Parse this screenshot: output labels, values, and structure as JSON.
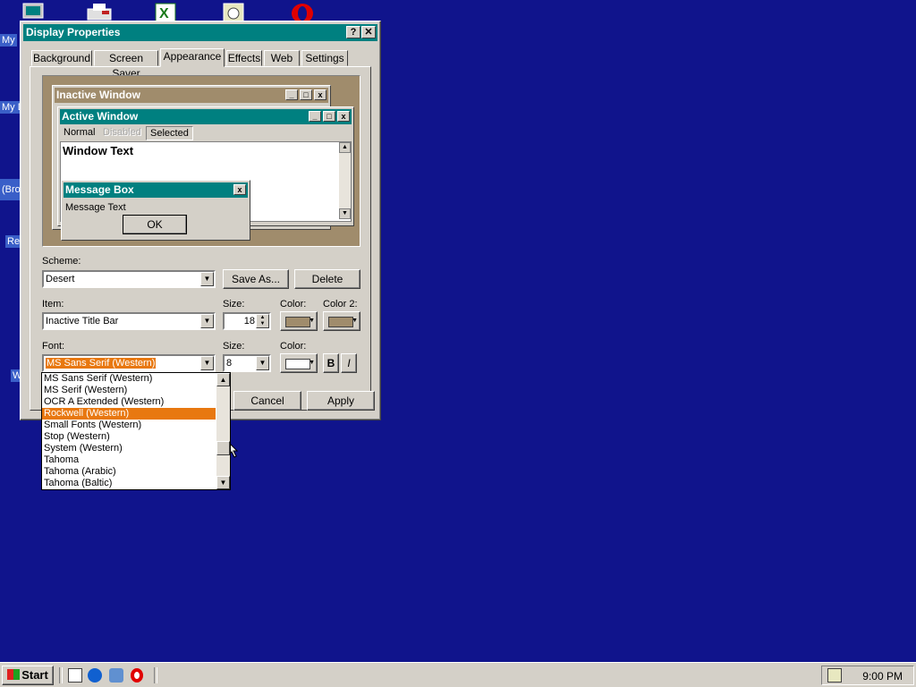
{
  "desktop": {
    "labels": [
      "My",
      "My D",
      "(Bro",
      "Re",
      "W"
    ]
  },
  "dialog": {
    "title": "Display Properties",
    "help_btn": "?",
    "close_btn": "✕",
    "tabs": [
      "Background",
      "Screen Saver",
      "Appearance",
      "Effects",
      "Web",
      "Settings"
    ],
    "active_tab": "Appearance",
    "preview": {
      "inactive_title": "Inactive Window",
      "active_title": "Active Window",
      "menu_normal": "Normal",
      "menu_disabled": "Disabled",
      "menu_selected": "Selected",
      "window_text": "Window Text",
      "msgbox_title": "Message Box",
      "msgbox_text": "Message Text",
      "ok": "OK"
    },
    "scheme_label": "Scheme:",
    "scheme_value": "Desert",
    "save_as": "Save As...",
    "delete": "Delete",
    "item_label": "Item:",
    "item_value": "Inactive Title Bar",
    "size_label": "Size:",
    "item_size": "18",
    "color_label": "Color:",
    "color2_label": "Color 2:",
    "font_label": "Font:",
    "font_value": "MS Sans Serif (Western)",
    "font_size_label": "Size:",
    "font_size": "8",
    "font_color_label": "Color:",
    "bold": "B",
    "italic": "I",
    "cancel": "Cancel",
    "apply": "Apply",
    "font_list": [
      "MS Sans Serif (Western)",
      "MS Serif (Western)",
      "OCR A Extended (Western)",
      "Rockwell (Western)",
      "Small Fonts (Western)",
      "Stop (Western)",
      "System (Western)",
      "Tahoma",
      "Tahoma (Arabic)",
      "Tahoma (Baltic)"
    ],
    "selected_font_index": 3
  },
  "colors": {
    "desktop": "#10148c",
    "title_active": "#008080",
    "title_inactive": "#a08c6c",
    "selection": "#e87810",
    "swatch_tan": "#a08c6c"
  },
  "taskbar": {
    "start": "Start",
    "clock": "9:00 PM"
  }
}
